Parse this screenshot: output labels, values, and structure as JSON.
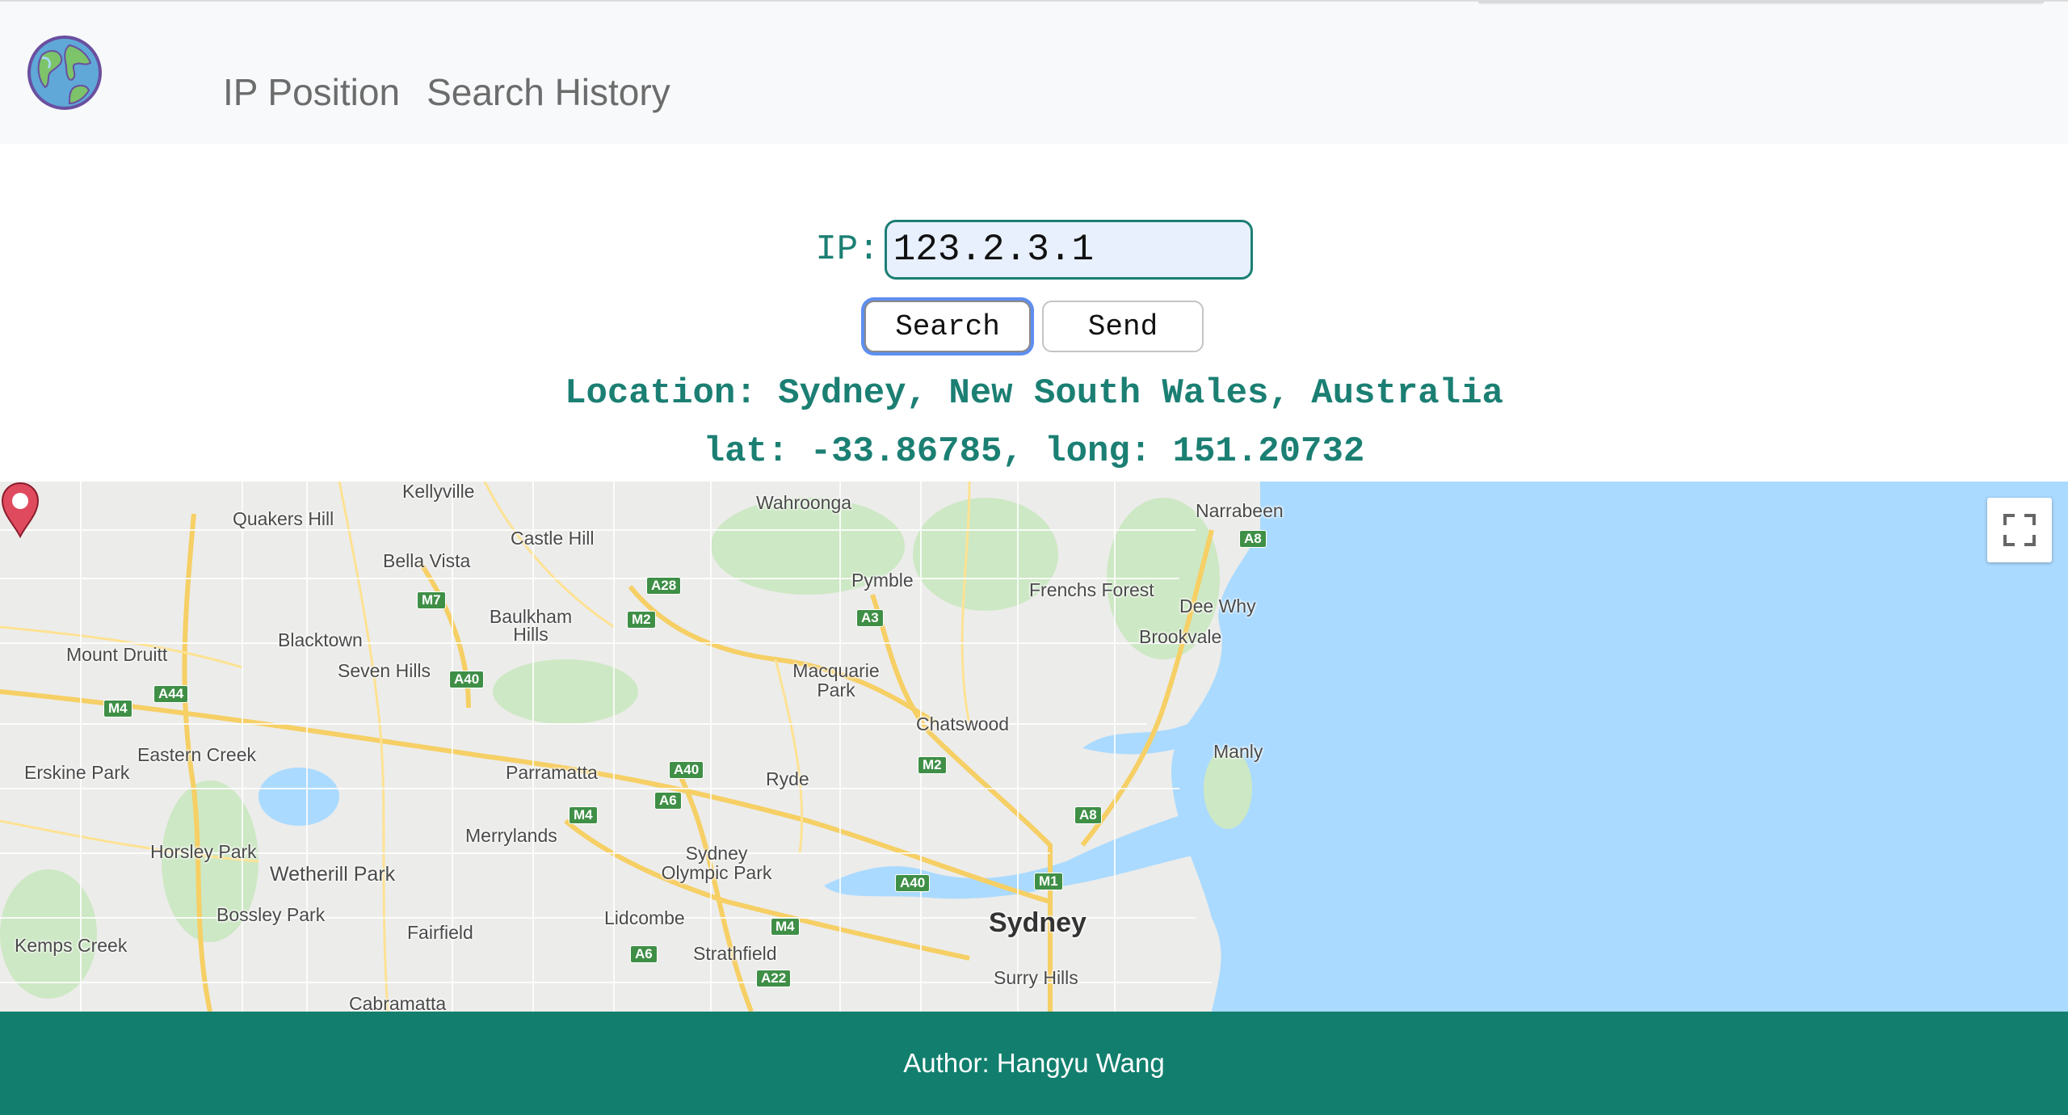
{
  "nav": {
    "logo_icon": "globe-icon",
    "links": [
      "IP Position",
      "Search History"
    ]
  },
  "form": {
    "ip_label": "IP:",
    "ip_value": "123.2.3.1",
    "search_label": "Search",
    "send_label": "Send"
  },
  "result": {
    "location_line": "Location: Sydney, New South Wales, Australia",
    "coords_line": "lat: -33.86785, long: 151.20732"
  },
  "map": {
    "places": [
      "Kellyville",
      "Quakers Hill",
      "Castle Hill",
      "Wahroonga",
      "Narrabeen",
      "Bella Vista",
      "Pymble",
      "Frenchs Forest",
      "Baulkham Hills",
      "Dee Why",
      "Blacktown",
      "Brookvale",
      "Mount Druitt",
      "Seven Hills",
      "Macquarie Park",
      "Chatswood",
      "Eastern Creek",
      "Erskine Park",
      "Parramatta",
      "Ryde",
      "Manly",
      "Merrylands",
      "Horsley Park",
      "Sydney Olympic Park",
      "Wetherill Park",
      "Bossley Park",
      "Lidcombe",
      "Sydney",
      "Fairfield",
      "Kemps Creek",
      "Strathfield",
      "Surry Hills",
      "Cabramatta"
    ],
    "shields": [
      "M7",
      "A28",
      "M2",
      "A3",
      "A8",
      "A40",
      "A44",
      "M4",
      "A40",
      "A6",
      "M2",
      "M4",
      "A8",
      "A40",
      "M1",
      "M4",
      "A6",
      "A22"
    ],
    "fullscreen_icon": "fullscreen-icon",
    "marker_icon": "map-pin-icon"
  },
  "footer": {
    "text": "Author: Hangyu Wang"
  }
}
